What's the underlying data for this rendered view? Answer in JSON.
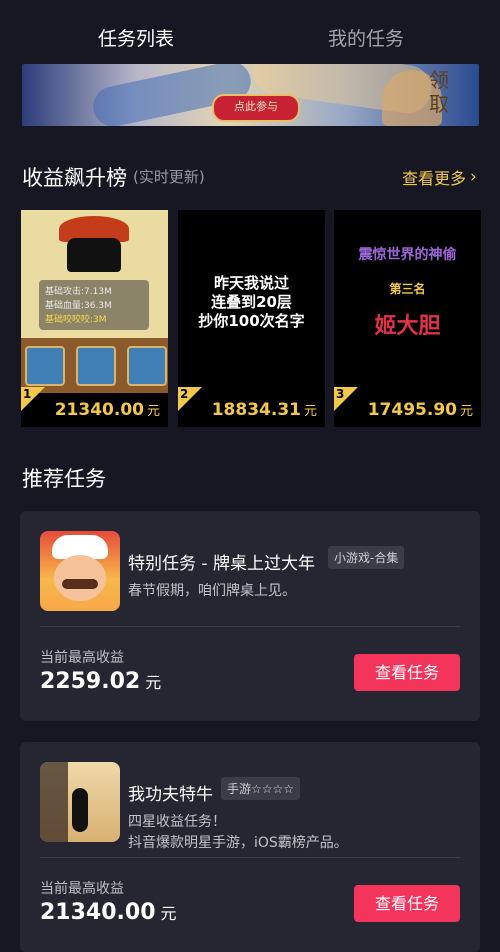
{
  "tabs": {
    "active": "任务列表",
    "inactive": "我的任务"
  },
  "banner": {
    "button_label": "点此参与",
    "side_text": "领取"
  },
  "ranking": {
    "title": "收益飙升榜",
    "note": "(实时更新)",
    "more_label": "查看更多",
    "cards": [
      {
        "rank": "1",
        "value": "21340.00",
        "unit": "元",
        "stats": [
          "基础攻击:7.13M",
          "基础血量:36.3M",
          "基础咬咬咬:3M"
        ]
      },
      {
        "rank": "2",
        "value": "18834.31",
        "unit": "元",
        "text": "昨天我说过\n连叠到20层\n抄你100次名字"
      },
      {
        "rank": "3",
        "value": "17495.90",
        "unit": "元",
        "line1": "震惊世界的神偷",
        "line2": "第三名",
        "line3": "姬大胆"
      }
    ]
  },
  "recommend": {
    "title": "推荐任务",
    "tasks": [
      {
        "name": "特别任务 - 牌桌上过大年",
        "tag": "小游戏-合集",
        "desc": "春节假期，咱们牌桌上见。",
        "earn_label": "当前最高收益",
        "earn_value": "2259.02",
        "earn_unit": "元",
        "button": "查看任务",
        "icon": "chef-icon"
      },
      {
        "name": "我功夫特牛",
        "tag": "手游☆☆☆☆",
        "desc_line1": "四星收益任务！",
        "desc_line2": "抖音爆款明星手游，iOS霸榜产品。",
        "earn_label": "当前最高收益",
        "earn_value": "21340.00",
        "earn_unit": "元",
        "button": "查看任务",
        "icon": "kungfu-icon"
      }
    ]
  },
  "colors": {
    "background": "#161722",
    "card": "#252632",
    "accent_gold": "#f2c94c",
    "button_red": "#f3355c"
  }
}
